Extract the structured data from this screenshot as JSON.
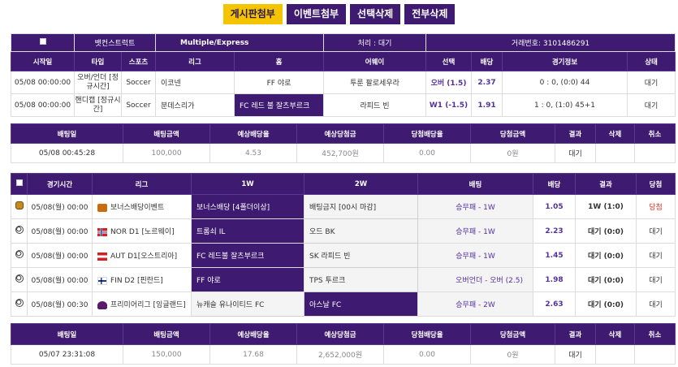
{
  "top_buttons": [
    "게시판첨부",
    "이벤트첨부",
    "선택삭제",
    "전부삭제"
  ],
  "bet1": {
    "header": {
      "type": "뱃컨스트럭트",
      "mode": "Multiple/Express",
      "status": "처리 : 대기",
      "trade": "거래번호: 3101486291"
    },
    "columns": [
      "시작일",
      "타입",
      "스포츠",
      "리그",
      "홈",
      "어웨이",
      "선택",
      "배당",
      "경기정보",
      "상태"
    ],
    "rows": [
      {
        "date": "05/08 00:00:00",
        "type": "오버/언더 [정규시간]",
        "sport": "Soccer",
        "league": "이코넨",
        "home": "FF 야로",
        "away": "투룬 팔로세우라",
        "pick": "오버 (1.5)",
        "odds": "2.37",
        "info": "0 : 0, (0:0) 44",
        "state": "대기"
      },
      {
        "date": "05/08 00:00:00",
        "type": "핸디캡 [정규시간]",
        "sport": "Soccer",
        "league": "분데스리가",
        "home": "FC 레드 불 잘츠부르크",
        "away": "라피드 빈",
        "pick": "W1 (-1.5)",
        "odds": "1.91",
        "info": "1 : 0, (1:0) 45+1",
        "state": "대기"
      }
    ],
    "summary_columns": [
      "배팅일",
      "배팅금액",
      "예상배당율",
      "예상당첨금",
      "당첨배당율",
      "당첨금액",
      "결과",
      "삭제",
      "취소"
    ],
    "summary": {
      "date": "05/08 00:45:28",
      "amount": "100,000",
      "exp_odds": "4.53",
      "exp_win": "452,700원",
      "win_odds": "0.00",
      "win_amount": "0원",
      "result": "대기"
    }
  },
  "bet2": {
    "columns": [
      "경기시간",
      "리그",
      "1W",
      "2W",
      "배팅",
      "배당",
      "결과",
      "당첨"
    ],
    "rows": [
      {
        "icon": "trophy-icon",
        "time": "05/08(월) 00:00",
        "flag": "bonus-icon",
        "league": "보너스배당이벤트",
        "home": "보너스배당 [4폴더이상]",
        "away": "배팅금지 [00시 마감]",
        "bet": "승무패 - 1W",
        "odds": "1.05",
        "result": "1W (1:0)",
        "win": "당첨",
        "sel": "home"
      },
      {
        "icon": "soccer-ball-icon",
        "time": "05/08(월) 00:00",
        "flag": "norway-flag-icon",
        "league": "NOR D1 [노르웨이]",
        "home": "트롬쇠 IL",
        "away": "오드 BK",
        "bet": "승무패 - 1W",
        "odds": "2.23",
        "result": "대기 (0:0)",
        "win": "대기",
        "sel": "home"
      },
      {
        "icon": "soccer-ball-icon",
        "time": "05/08(월) 00:00",
        "flag": "austria-flag-icon",
        "league": "AUT D1[오스트리아]",
        "home": "FC 레드불 잘츠부르크",
        "away": "SK 라피드 빈",
        "bet": "승무패 - 1W",
        "odds": "1.45",
        "result": "대기 (0:0)",
        "win": "대기",
        "sel": "home"
      },
      {
        "icon": "soccer-ball-icon",
        "time": "05/08(월) 00:00",
        "flag": "finland-flag-icon",
        "league": "FIN D2 [핀란드]",
        "home": "FF 야로",
        "away": "TPS 투르크",
        "bet": "오버언더 - 오버 (2.5)",
        "odds": "1.98",
        "result": "대기 (0:0)",
        "win": "대기",
        "sel": "home"
      },
      {
        "icon": "soccer-ball-icon",
        "time": "05/08(월) 00:30",
        "flag": "england-league-icon",
        "league": "프리미어리그 [잉글랜드]",
        "home": "뉴캐슬 유나이티드 FC",
        "away": "아스날 FC",
        "bet": "승무패 - 2W",
        "odds": "2.63",
        "result": "대기 (0:0)",
        "win": "대기",
        "sel": "away"
      }
    ],
    "summary_columns": [
      "배팅일",
      "배팅금액",
      "예상배당율",
      "예상당첨금",
      "당첨배당율",
      "당첨금액",
      "결과",
      "삭제",
      "취소"
    ],
    "summary": {
      "date": "05/07 23:31:08",
      "amount": "150,000",
      "exp_odds": "17.68",
      "exp_win": "2,652,000원",
      "win_odds": "0.00",
      "win_amount": "0원",
      "result": "대기"
    }
  }
}
